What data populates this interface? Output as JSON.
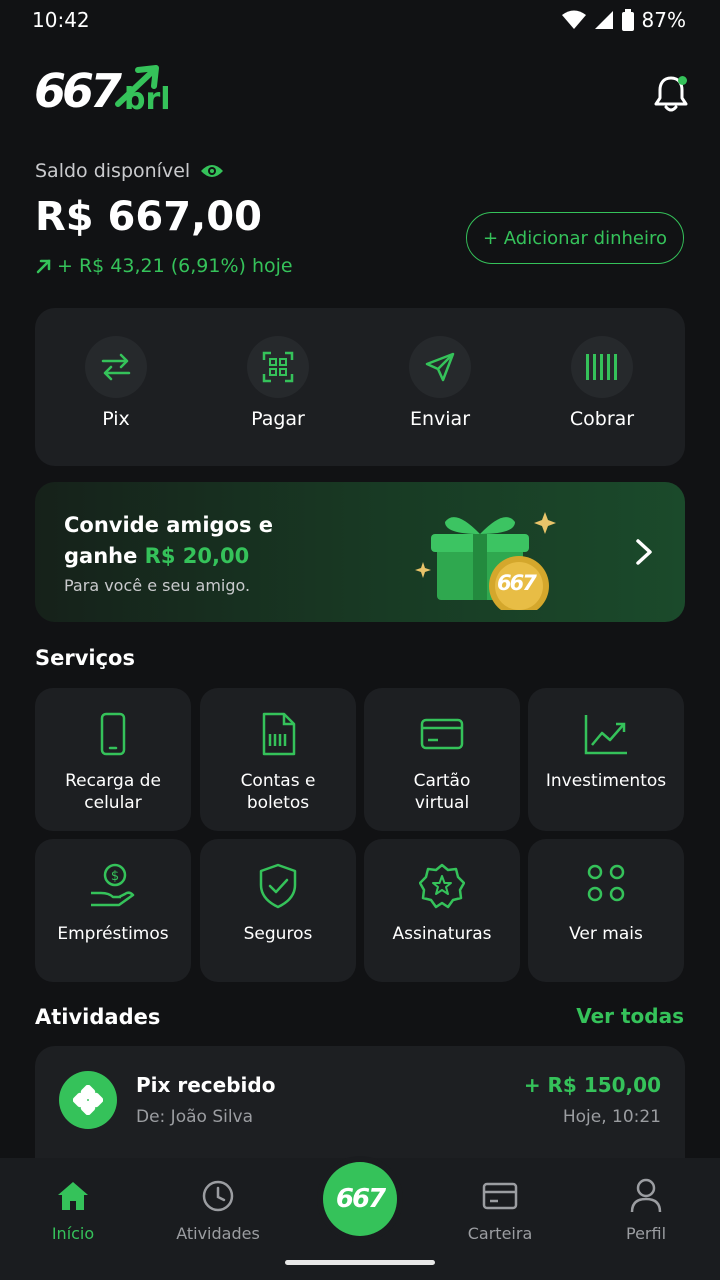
{
  "status_bar": {
    "time": "10:42",
    "battery": "87%"
  },
  "header": {
    "logo_number": "667",
    "logo_suffix": "brl",
    "notification_badge": true
  },
  "balance": {
    "label": "Saldo disponível",
    "value": "R$ 667,00",
    "change": "+ R$ 43,21 (6,91%) hoje",
    "add_money_label": "+ Adicionar dinheiro"
  },
  "quick_actions": [
    {
      "label": "Pix",
      "icon": "transfer-arrows-icon"
    },
    {
      "label": "Pagar",
      "icon": "qr-scan-icon"
    },
    {
      "label": "Enviar",
      "icon": "send-icon"
    },
    {
      "label": "Cobrar",
      "icon": "barcode-icon"
    }
  ],
  "promo": {
    "title_line1": "Convide amigos e",
    "title_line2_prefix": "ganhe ",
    "title_line2_highlight": "R$ 20,00",
    "subtitle": "Para você e seu amigo.",
    "coin_text": "667"
  },
  "services": {
    "title": "Serviços",
    "items": [
      {
        "line1": "Recarga de",
        "line2": "celular",
        "icon": "phone-icon"
      },
      {
        "line1": "Contas e",
        "line2": "boletos",
        "icon": "bill-icon"
      },
      {
        "line1": "Cartão",
        "line2": "virtual",
        "icon": "card-icon"
      },
      {
        "line1": "Investimentos",
        "line2": "",
        "icon": "chart-trend-icon"
      },
      {
        "line1": "Empréstimos",
        "line2": "",
        "icon": "loan-hand-icon"
      },
      {
        "line1": "Seguros",
        "line2": "",
        "icon": "shield-check-icon"
      },
      {
        "line1": "Assinaturas",
        "line2": "",
        "icon": "star-badge-icon"
      },
      {
        "line1": "Ver mais",
        "line2": "",
        "icon": "grid-dots-icon"
      }
    ]
  },
  "activities": {
    "title": "Atividades",
    "see_all": "Ver todas",
    "items": [
      {
        "title": "Pix recebido",
        "subtitle": "De: João Silva",
        "amount": "+ R$ 150,00",
        "time": "Hoje, 10:21"
      }
    ]
  },
  "bottom_nav": {
    "items": [
      {
        "label": "Início",
        "icon": "home-icon",
        "active": true
      },
      {
        "label": "Atividades",
        "icon": "clock-icon",
        "active": false
      },
      {
        "label": "Carteira",
        "icon": "wallet-icon",
        "active": false
      },
      {
        "label": "Perfil",
        "icon": "person-icon",
        "active": false
      }
    ],
    "center_label": "667"
  },
  "colors": {
    "accent": "#35c25a",
    "background": "#111214",
    "card": "#1d1f22"
  }
}
